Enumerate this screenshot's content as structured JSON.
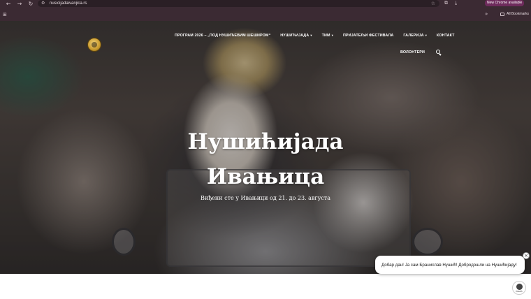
{
  "browser": {
    "url": "nusicijadaivanjica.rs",
    "new_chrome_label": "New Chrome available",
    "all_bookmarks_label": "All Bookmarks"
  },
  "site": {
    "nav": [
      {
        "label": "ПРОГРАМ 2026 – „ПОД НУШИЋЕВИМ ШЕШИРОМ“",
        "has_menu": false
      },
      {
        "label": "НУШИЋИЈАДА",
        "has_menu": true
      },
      {
        "label": "ТИМ",
        "has_menu": true
      },
      {
        "label": "ПРИЈАТЕЉИ ФЕСТИВАЛА",
        "has_menu": false
      },
      {
        "label": "ГАЛЕРИЈА",
        "has_menu": true
      },
      {
        "label": "КОНТАКТ",
        "has_menu": false
      }
    ],
    "nav_second": {
      "label": "ВОЛОНТЕРИ"
    },
    "hero": {
      "title_line1": "Нушићијада",
      "title_line2": "Ивањица",
      "subtitle": "Виђени сте у Ивањици од 21. до 23. августа"
    },
    "chat": {
      "message": "Добар дан! Ја сам Бранислав Нушић! Добродошли на Нушићијаду!",
      "close_symbol": "×",
      "avatar_label": "НУШИЋ"
    }
  },
  "colors": {
    "browser_frame": "#3b2a33",
    "new_chrome_badge": "#6e2b5c",
    "nav_text": "#ffffff"
  },
  "icons": {
    "menu_caret": "▾",
    "search": "search-icon",
    "logo": "festival-logo"
  }
}
